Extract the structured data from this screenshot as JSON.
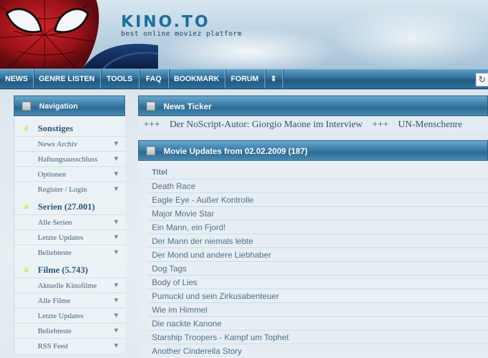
{
  "header": {
    "logo_title": "KINO.TO",
    "logo_subtitle": "best online moviez platform"
  },
  "navbar": {
    "items": [
      {
        "label": "NEWS"
      },
      {
        "label": "GENRE LISTEN"
      },
      {
        "label": "TOOLS"
      },
      {
        "label": "FAQ"
      },
      {
        "label": "BOOKMARK"
      },
      {
        "label": "FORUM"
      },
      {
        "label": "⇕"
      }
    ],
    "refresh_icon": "↻"
  },
  "sidebar": {
    "title": "Navigation",
    "sections": [
      {
        "title": "Sonstiges",
        "links": [
          "News Archiv",
          "Haftungsausschluss",
          "Optionen",
          "Register / Login"
        ]
      },
      {
        "title": "Serien (27.001)",
        "links": [
          "Alle Serien",
          "Letzte Updates",
          "Beliebteste"
        ]
      },
      {
        "title": "Filme (5.743)",
        "links": [
          "Aktuelle Kinofilme",
          "Alle Filme",
          "Letzte Updates",
          "Beliebteste",
          "RSS Feed"
        ]
      }
    ]
  },
  "ticker": {
    "title": "News Ticker",
    "separator": "+++",
    "items": [
      "Der NoScript-Autor: Giorgio Maone im Interview",
      "UN-Menschenre"
    ]
  },
  "updates": {
    "title": "Movie Updates from 02.02.2009 (187)",
    "column_header": "Titel",
    "movies": [
      "Death Race",
      "Eagle Eye - Außer Kontrolle",
      "Major Movie Star",
      "Ein Mann, ein Fjord!",
      "Der Mann der niemals lebte",
      "Der Mond und andere Liebhaber",
      "Dog Tags",
      "Body of Lies",
      "Pumuckl und sein Zirkusabenteuer",
      "Wie im Himmel",
      "Die nackte Kanone",
      "Starship Troopers - Kampf um Tophet",
      "Another Cinderella Story"
    ]
  }
}
